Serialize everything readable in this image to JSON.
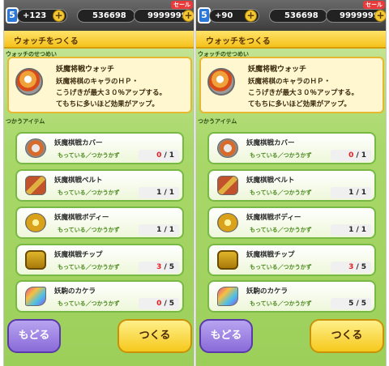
{
  "screens": [
    {
      "status": {
        "level": "5",
        "stamina": "+123",
        "money": "536698",
        "coins": "9999999",
        "sale_badge": "セール"
      },
      "title": "ウォッチをつくる",
      "section_desc_label": "ウォッチのせつめい",
      "watch_name": "妖魔将戦ウォッチ",
      "description_lines": [
        "妖魔将棋のキャラのＨＰ・",
        "こうげきが最大３０％アップする。",
        "てもちに多いほど効果がアップ。"
      ],
      "section_items_label": "つかうアイテム",
      "items": [
        {
          "name": "妖魔棋戦カバー",
          "sub": "もっている／つかうかず",
          "have": "0",
          "need": "1",
          "short": true,
          "icon": "cover-icon"
        },
        {
          "name": "妖魔棋戦ベルト",
          "sub": "もっている／つかうかず",
          "have": "1",
          "need": "1",
          "short": false,
          "icon": "belt-icon"
        },
        {
          "name": "妖魔棋戦ボディー",
          "sub": "もっている／つかうかず",
          "have": "1",
          "need": "1",
          "short": false,
          "icon": "body-icon"
        },
        {
          "name": "妖魔棋戦チップ",
          "sub": "もっている／つかうかず",
          "have": "3",
          "need": "5",
          "short": true,
          "icon": "chip-icon"
        },
        {
          "name": "妖駒のカケラ",
          "sub": "もっている／つかうかず",
          "have": "0",
          "need": "5",
          "short": true,
          "icon": "shard-icon"
        }
      ],
      "back_label": "もどる",
      "make_label": "つくる"
    },
    {
      "status": {
        "level": "5",
        "stamina": "+90",
        "money": "536698",
        "coins": "9999999",
        "sale_badge": "セール"
      },
      "title": "ウォッチをつくる",
      "section_desc_label": "ウォッチのせつめい",
      "watch_name": "妖魔将戦ウォッチ",
      "description_lines": [
        "妖魔将棋のキャラのＨＰ・",
        "こうげきが最大３０％アップする。",
        "てもちに多いほど効果がアップ。"
      ],
      "section_items_label": "つかうアイテム",
      "items": [
        {
          "name": "妖魔棋戦カバー",
          "sub": "もっている／つかうかず",
          "have": "0",
          "need": "1",
          "short": true,
          "icon": "cover-icon"
        },
        {
          "name": "妖魔棋戦ベルト",
          "sub": "もっている／つかうかず",
          "have": "1",
          "need": "1",
          "short": false,
          "icon": "belt-icon"
        },
        {
          "name": "妖魔棋戦ボディー",
          "sub": "もっている／つかうかず",
          "have": "1",
          "need": "1",
          "short": false,
          "icon": "body-icon"
        },
        {
          "name": "妖魔棋戦チップ",
          "sub": "もっている／つかうかず",
          "have": "3",
          "need": "5",
          "short": true,
          "icon": "chip-icon"
        },
        {
          "name": "妖駒のカケラ",
          "sub": "もっている／つかうかず",
          "have": "5",
          "need": "5",
          "short": false,
          "icon": "shard-icon"
        }
      ],
      "back_label": "もどる",
      "make_label": "つくる"
    }
  ]
}
